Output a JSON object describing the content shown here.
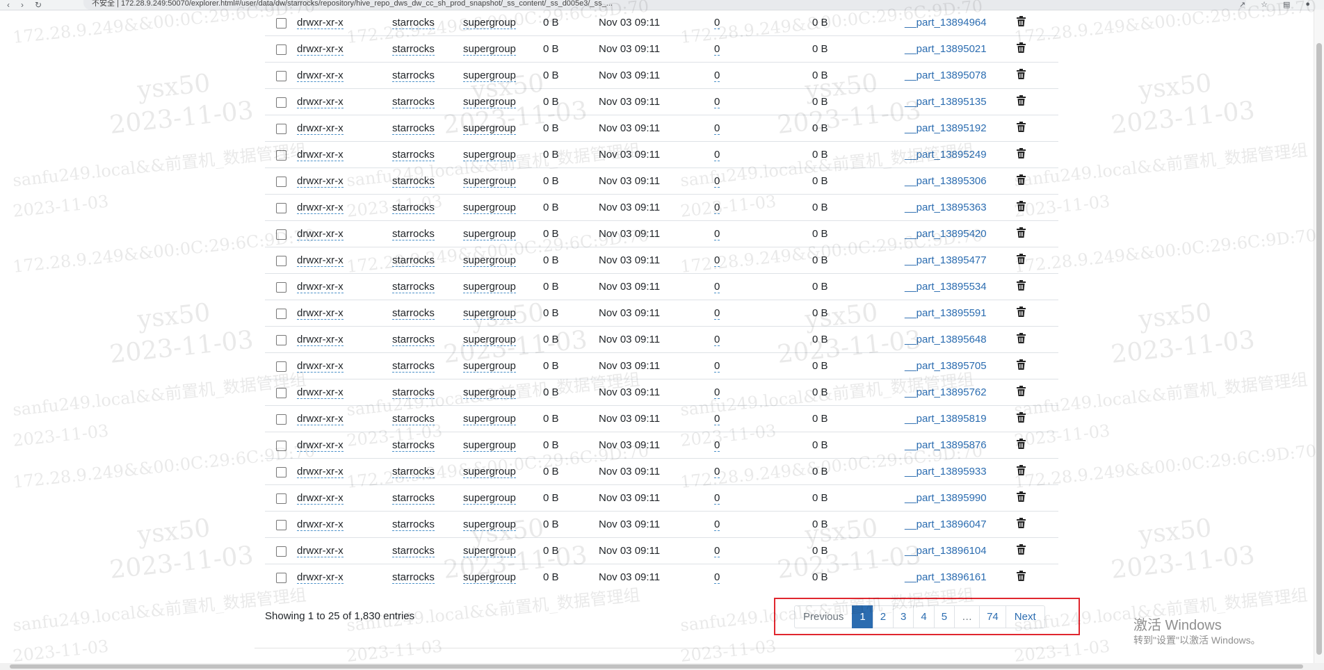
{
  "browser": {
    "url_text": "不安全 | 172.28.9.249:50070/explorer.html#/user/data/dw/starrocks/repository/hive_repo_dws_dw_cc_sh_prod_snapshot/_ss_content/_ss_d005e3/_ss_..."
  },
  "table": {
    "rows": [
      {
        "permission": "drwxr-xr-x",
        "owner": "starrocks",
        "group": "supergroup",
        "size": "0 B",
        "modified": "Nov 03 09:11",
        "replication": "0",
        "block_size": "0 B",
        "name": "__part_13894964"
      },
      {
        "permission": "drwxr-xr-x",
        "owner": "starrocks",
        "group": "supergroup",
        "size": "0 B",
        "modified": "Nov 03 09:11",
        "replication": "0",
        "block_size": "0 B",
        "name": "__part_13895021"
      },
      {
        "permission": "drwxr-xr-x",
        "owner": "starrocks",
        "group": "supergroup",
        "size": "0 B",
        "modified": "Nov 03 09:11",
        "replication": "0",
        "block_size": "0 B",
        "name": "__part_13895078"
      },
      {
        "permission": "drwxr-xr-x",
        "owner": "starrocks",
        "group": "supergroup",
        "size": "0 B",
        "modified": "Nov 03 09:11",
        "replication": "0",
        "block_size": "0 B",
        "name": "__part_13895135"
      },
      {
        "permission": "drwxr-xr-x",
        "owner": "starrocks",
        "group": "supergroup",
        "size": "0 B",
        "modified": "Nov 03 09:11",
        "replication": "0",
        "block_size": "0 B",
        "name": "__part_13895192"
      },
      {
        "permission": "drwxr-xr-x",
        "owner": "starrocks",
        "group": "supergroup",
        "size": "0 B",
        "modified": "Nov 03 09:11",
        "replication": "0",
        "block_size": "0 B",
        "name": "__part_13895249"
      },
      {
        "permission": "drwxr-xr-x",
        "owner": "starrocks",
        "group": "supergroup",
        "size": "0 B",
        "modified": "Nov 03 09:11",
        "replication": "0",
        "block_size": "0 B",
        "name": "__part_13895306"
      },
      {
        "permission": "drwxr-xr-x",
        "owner": "starrocks",
        "group": "supergroup",
        "size": "0 B",
        "modified": "Nov 03 09:11",
        "replication": "0",
        "block_size": "0 B",
        "name": "__part_13895363"
      },
      {
        "permission": "drwxr-xr-x",
        "owner": "starrocks",
        "group": "supergroup",
        "size": "0 B",
        "modified": "Nov 03 09:11",
        "replication": "0",
        "block_size": "0 B",
        "name": "__part_13895420"
      },
      {
        "permission": "drwxr-xr-x",
        "owner": "starrocks",
        "group": "supergroup",
        "size": "0 B",
        "modified": "Nov 03 09:11",
        "replication": "0",
        "block_size": "0 B",
        "name": "__part_13895477"
      },
      {
        "permission": "drwxr-xr-x",
        "owner": "starrocks",
        "group": "supergroup",
        "size": "0 B",
        "modified": "Nov 03 09:11",
        "replication": "0",
        "block_size": "0 B",
        "name": "__part_13895534"
      },
      {
        "permission": "drwxr-xr-x",
        "owner": "starrocks",
        "group": "supergroup",
        "size": "0 B",
        "modified": "Nov 03 09:11",
        "replication": "0",
        "block_size": "0 B",
        "name": "__part_13895591"
      },
      {
        "permission": "drwxr-xr-x",
        "owner": "starrocks",
        "group": "supergroup",
        "size": "0 B",
        "modified": "Nov 03 09:11",
        "replication": "0",
        "block_size": "0 B",
        "name": "__part_13895648"
      },
      {
        "permission": "drwxr-xr-x",
        "owner": "starrocks",
        "group": "supergroup",
        "size": "0 B",
        "modified": "Nov 03 09:11",
        "replication": "0",
        "block_size": "0 B",
        "name": "__part_13895705"
      },
      {
        "permission": "drwxr-xr-x",
        "owner": "starrocks",
        "group": "supergroup",
        "size": "0 B",
        "modified": "Nov 03 09:11",
        "replication": "0",
        "block_size": "0 B",
        "name": "__part_13895762"
      },
      {
        "permission": "drwxr-xr-x",
        "owner": "starrocks",
        "group": "supergroup",
        "size": "0 B",
        "modified": "Nov 03 09:11",
        "replication": "0",
        "block_size": "0 B",
        "name": "__part_13895819"
      },
      {
        "permission": "drwxr-xr-x",
        "owner": "starrocks",
        "group": "supergroup",
        "size": "0 B",
        "modified": "Nov 03 09:11",
        "replication": "0",
        "block_size": "0 B",
        "name": "__part_13895876"
      },
      {
        "permission": "drwxr-xr-x",
        "owner": "starrocks",
        "group": "supergroup",
        "size": "0 B",
        "modified": "Nov 03 09:11",
        "replication": "0",
        "block_size": "0 B",
        "name": "__part_13895933"
      },
      {
        "permission": "drwxr-xr-x",
        "owner": "starrocks",
        "group": "supergroup",
        "size": "0 B",
        "modified": "Nov 03 09:11",
        "replication": "0",
        "block_size": "0 B",
        "name": "__part_13895990"
      },
      {
        "permission": "drwxr-xr-x",
        "owner": "starrocks",
        "group": "supergroup",
        "size": "0 B",
        "modified": "Nov 03 09:11",
        "replication": "0",
        "block_size": "0 B",
        "name": "__part_13896047"
      },
      {
        "permission": "drwxr-xr-x",
        "owner": "starrocks",
        "group": "supergroup",
        "size": "0 B",
        "modified": "Nov 03 09:11",
        "replication": "0",
        "block_size": "0 B",
        "name": "__part_13896104"
      },
      {
        "permission": "drwxr-xr-x",
        "owner": "starrocks",
        "group": "supergroup",
        "size": "0 B",
        "modified": "Nov 03 09:11",
        "replication": "0",
        "block_size": "0 B",
        "name": "__part_13896161"
      }
    ]
  },
  "footer": {
    "info": "Showing 1 to 25 of 1,830 entries"
  },
  "pagination": {
    "previous": "Previous",
    "pages": [
      "1",
      "2",
      "3",
      "4",
      "5"
    ],
    "ellipsis": "…",
    "last": "74",
    "next": "Next",
    "active": "1"
  },
  "overlay": {
    "activate_title": "激活 Windows",
    "activate_subtitle": "转到\"设置\"以激活 Windows。"
  },
  "watermark": {
    "user": "ysx50",
    "date": "2023-11-03",
    "host": "sanfu249.local&&前置机_数据管理组",
    "ipmac": "172.28.9.249&&00:0C:29:6C:9D:70"
  },
  "colors": {
    "link": "#2b6cb0",
    "active_page": "#2b6cb0",
    "highlight": "#e0262e"
  }
}
